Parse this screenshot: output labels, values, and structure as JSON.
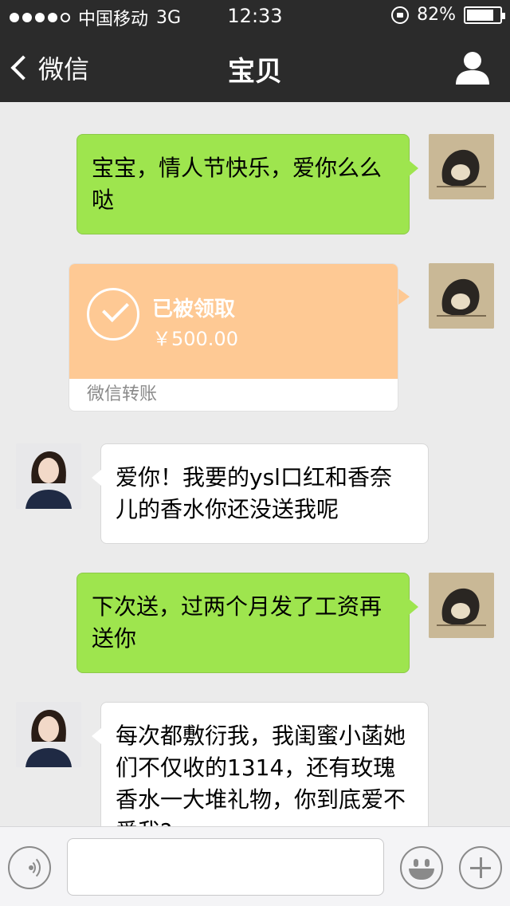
{
  "status_bar": {
    "carrier": "中国移动",
    "network": "3G",
    "time": "12:33",
    "battery_percent": "82%",
    "battery_level": 0.82,
    "signal_dots_filled": 4,
    "signal_dots_total": 5
  },
  "nav": {
    "back_label": "微信",
    "title": "宝贝",
    "icons": {
      "back": "chevron-left-icon",
      "profile": "person-icon"
    }
  },
  "messages": [
    {
      "from": "self",
      "type": "text",
      "text": "宝宝，情人节快乐，爱你么么哒"
    },
    {
      "from": "self",
      "type": "transfer",
      "status": "已被领取",
      "amount": "￥500.00",
      "source": "微信转账"
    },
    {
      "from": "friend",
      "type": "text",
      "text": "爱你！我要的ysl口红和香奈儿的香水你还没送我呢"
    },
    {
      "from": "self",
      "type": "text",
      "text": "下次送，过两个月发了工资再送你"
    },
    {
      "from": "friend",
      "type": "text",
      "text": "每次都敷衍我，我闺蜜小菡她们不仅收的1314，还有玫瑰香水一大堆礼物，你到底爱不爱我?"
    }
  ],
  "input_bar": {
    "placeholder": "",
    "icons": {
      "voice": "voice-icon",
      "emoji": "emoji-icon",
      "more": "plus-icon"
    }
  },
  "colors": {
    "nav_bg": "#2b2b2b",
    "chat_bg": "#ebebeb",
    "self_bubble": "#9ee54e",
    "friend_bubble": "#ffffff",
    "transfer_bg": "#fec994"
  }
}
